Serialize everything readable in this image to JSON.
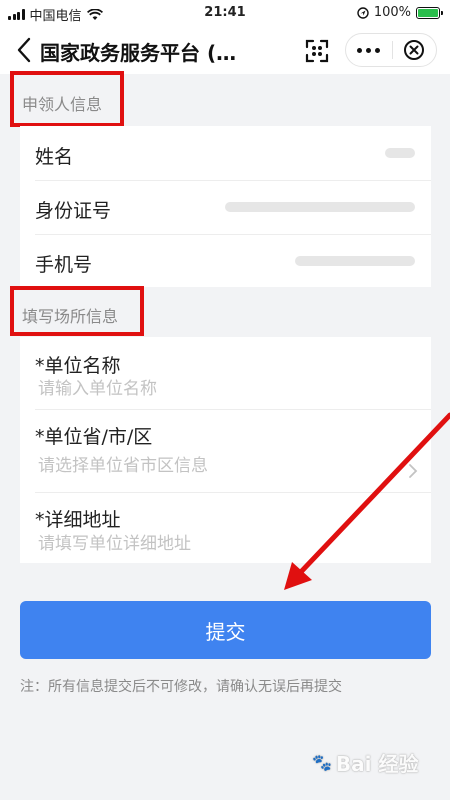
{
  "status_bar": {
    "carrier": "中国电信",
    "time": "21:41",
    "battery": "100%"
  },
  "nav": {
    "title": "国家政务服务平台 (…"
  },
  "applicant_section": {
    "title": "申领人信息",
    "rows": [
      {
        "label": "姓名"
      },
      {
        "label": "身份证号"
      },
      {
        "label": "手机号"
      }
    ]
  },
  "venue_section": {
    "title": "填写场所信息",
    "fields": [
      {
        "label": "*单位名称",
        "placeholder": "请输入单位名称"
      },
      {
        "label": "*单位省/市/区",
        "placeholder": "请选择单位省市区信息"
      },
      {
        "label": "*详细地址",
        "placeholder": "请填写单位详细地址"
      }
    ]
  },
  "submit_label": "提交",
  "note": "注：所有信息提交后不可修改，请确认无误后再提交",
  "watermark": "Bai 经验",
  "colors": {
    "primary": "#3f83f0",
    "highlight": "#e01010",
    "background": "#f2f3f5",
    "placeholder": "#c3c3c3"
  },
  "icons": [
    "signal-icon",
    "wifi-icon",
    "location-lock-icon",
    "battery-icon",
    "back-icon",
    "scan-icon",
    "more-icon",
    "close-icon",
    "chevron-right-icon",
    "arrow-annotation"
  ]
}
